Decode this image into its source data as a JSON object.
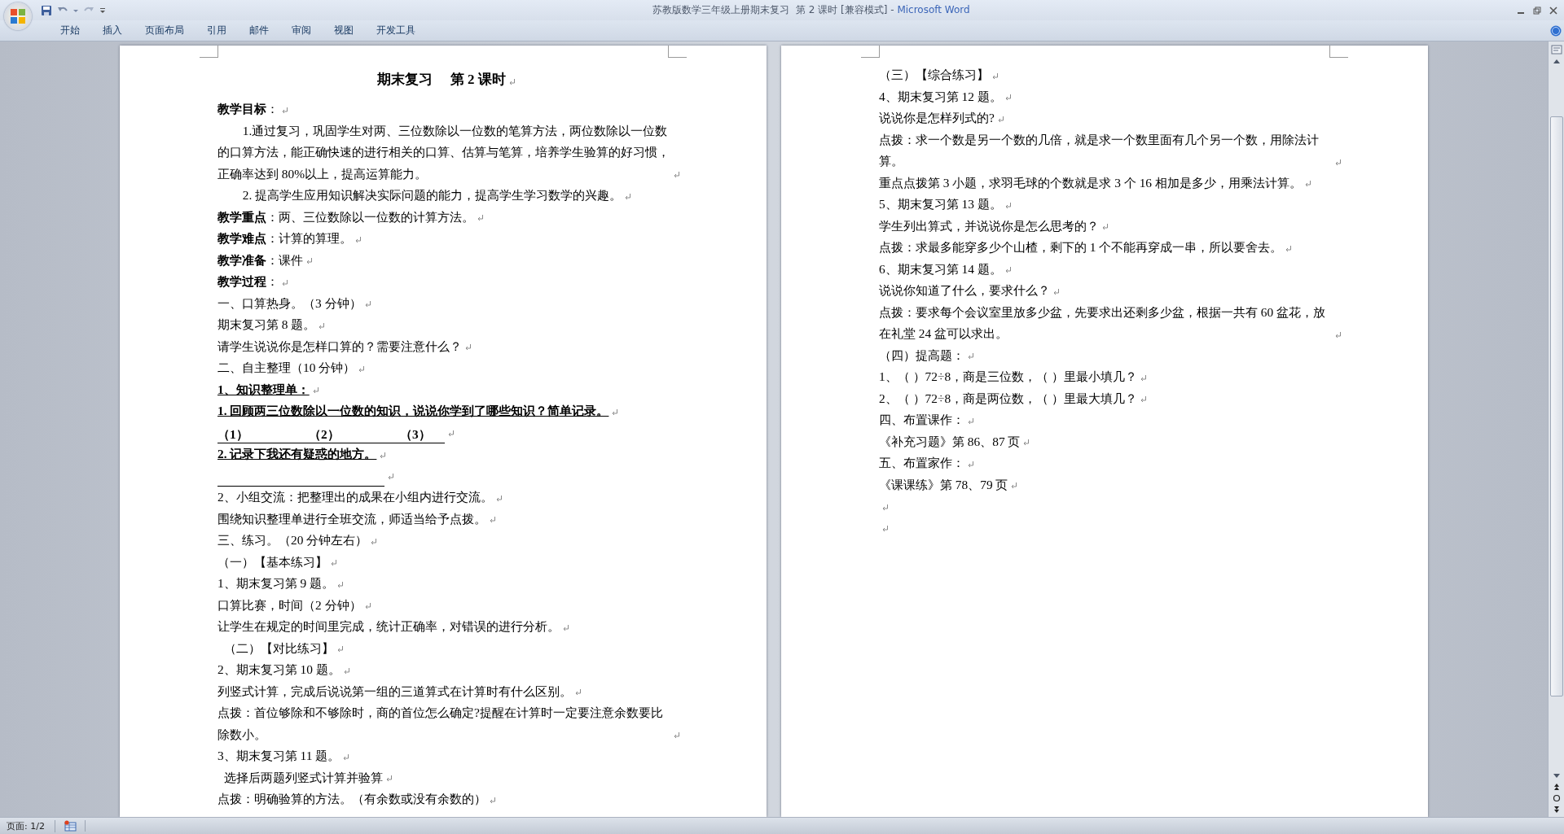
{
  "window": {
    "document_title": "苏教版数学三年级上册期末复习  第 2 课时 [兼容模式]",
    "separator": " - ",
    "app_name": "Microsoft Word"
  },
  "ribbon_tabs": [
    {
      "label": "开始",
      "selected": false
    },
    {
      "label": "插入",
      "selected": false
    },
    {
      "label": "页面布局",
      "selected": false
    },
    {
      "label": "引用",
      "selected": false
    },
    {
      "label": "邮件",
      "selected": false
    },
    {
      "label": "审阅",
      "selected": false
    },
    {
      "label": "视图",
      "selected": false
    },
    {
      "label": "开发工具",
      "selected": false
    }
  ],
  "pages": [
    {
      "paragraphs": [
        {
          "kind": "title",
          "text": "期末复习　 第 2 课时"
        },
        {
          "kind": "body",
          "text": "**教学目标**："
        },
        {
          "kind": "indent",
          "text": "1.通过复习，巩固学生对两、三位数除以一位数的笔算方法，两位数除以一位数的口算方法，能正确快速的进行相关的口算、估算与笔算，培养学生验算的好习惯，正确率达到 80%以上，提高运算能力。"
        },
        {
          "kind": "indent",
          "text": "2. 提高学生应用知识解决实际问题的能力，提高学生学习数学的兴趣。"
        },
        {
          "kind": "body",
          "text": "**教学重点**：两、三位数除以一位数的计算方法。"
        },
        {
          "kind": "body",
          "text": "**教学难点**：计算的算理。"
        },
        {
          "kind": "body",
          "text": "**教学准备**：课件"
        },
        {
          "kind": "body",
          "text": "**教学过程**："
        },
        {
          "kind": "body",
          "text": "一、口算热身。（3 分钟）"
        },
        {
          "kind": "body",
          "text": "期末复习第 8 题。"
        },
        {
          "kind": "body",
          "text": "请学生说说你是怎样口算的？需要注意什么？"
        },
        {
          "kind": "body",
          "text": "二、自主整理（10 分钟）"
        },
        {
          "kind": "bold-underline",
          "text": "1、知识整理单："
        },
        {
          "kind": "bold-underline",
          "text": "1. 回顾两三位数除以一位数的知识，说说你学到了哪些知识？简单记录。"
        },
        {
          "kind": "blanks",
          "items": [
            "（1）",
            "（2）",
            "（3）"
          ]
        },
        {
          "kind": "bold-underline",
          "text": "2. 记录下我还有疑惑的地方。"
        },
        {
          "kind": "line"
        },
        {
          "kind": "body",
          "text": "2、小组交流：把整理出的成果在小组内进行交流。"
        },
        {
          "kind": "body",
          "text": "围绕知识整理单进行全班交流，师适当给予点拨。"
        },
        {
          "kind": "body",
          "text": "三、练习。（20 分钟左右）"
        },
        {
          "kind": "body",
          "text": "（一）【基本练习】"
        },
        {
          "kind": "body",
          "text": "1、期末复习第 9 题。"
        },
        {
          "kind": "body",
          "text": "口算比赛，时间（2 分钟）"
        },
        {
          "kind": "body",
          "text": "让学生在规定的时间里完成，统计正确率，对错误的进行分析。"
        },
        {
          "kind": "nudge",
          "text": "（二）【对比练习】"
        },
        {
          "kind": "body",
          "text": "2、期末复习第 10 题。"
        },
        {
          "kind": "body",
          "text": "列竖式计算，完成后说说第一组的三道算式在计算时有什么区别。"
        },
        {
          "kind": "body",
          "text": "点拨：首位够除和不够除时，商的首位怎么确定?提醒在计算时一定要注意余数要比除数小。"
        },
        {
          "kind": "body",
          "text": "3、期末复习第 11 题。"
        },
        {
          "kind": "nudge",
          "text": "选择后两题列竖式计算并验算"
        },
        {
          "kind": "body",
          "text": "点拨：明确验算的方法。（有余数或没有余数的）"
        }
      ]
    },
    {
      "paragraphs": [
        {
          "kind": "body",
          "text": "（三）【综合练习】"
        },
        {
          "kind": "body",
          "text": "4、期末复习第 12 题。"
        },
        {
          "kind": "body",
          "text": "说说你是怎样列式的?"
        },
        {
          "kind": "body",
          "text": "点拨：求一个数是另一个数的几倍，就是求一个数里面有几个另一个数，用除法计算。"
        },
        {
          "kind": "body",
          "text": "重点点拨第 3 小题，求羽毛球的个数就是求 3 个 16 相加是多少，用乘法计算。"
        },
        {
          "kind": "body",
          "text": "5、期末复习第 13 题。"
        },
        {
          "kind": "body",
          "text": "学生列出算式，并说说你是怎么思考的？"
        },
        {
          "kind": "body",
          "text": "点拨：求最多能穿多少个山楂，剩下的 1 个不能再穿成一串，所以要舍去。"
        },
        {
          "kind": "body",
          "text": "6、期末复习第 14 题。"
        },
        {
          "kind": "body",
          "text": "说说你知道了什么，要求什么？"
        },
        {
          "kind": "body",
          "text": "点拨：要求每个会议室里放多少盆，先要求出还剩多少盆，根据一共有 60 盆花，放在礼堂 24 盆可以求出。"
        },
        {
          "kind": "body",
          "text": "（四）提高题："
        },
        {
          "kind": "body",
          "text": "1、（ ）72÷8，商是三位数，（ ）里最小填几？"
        },
        {
          "kind": "body",
          "text": "2、（ ）72÷8，商是两位数，（ ）里最大填几？"
        },
        {
          "kind": "body",
          "text": "四、布置课作："
        },
        {
          "kind": "body",
          "text": "《补充习题》第 86、87 页"
        },
        {
          "kind": "body",
          "text": "五、布置家作："
        },
        {
          "kind": "body",
          "text": "《课课练》第 78、79 页"
        },
        {
          "kind": "empty"
        },
        {
          "kind": "empty"
        }
      ]
    }
  ],
  "status_bar": {
    "page": "页面: 1/2"
  }
}
